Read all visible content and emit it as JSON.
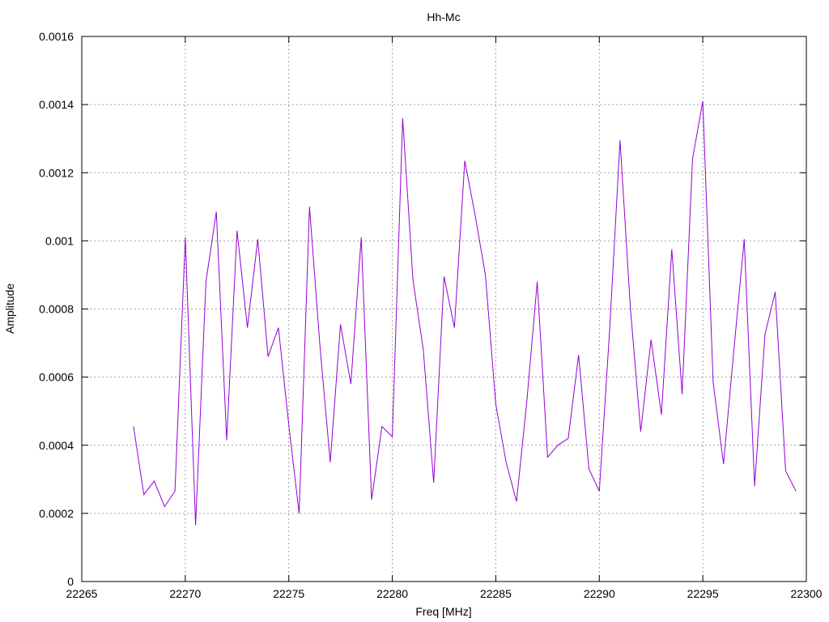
{
  "chart_data": {
    "type": "line",
    "title": "Hh-Mc",
    "xlabel": "Freq [MHz]",
    "ylabel": "Amplitude",
    "xlim": [
      22265,
      22300
    ],
    "ylim": [
      0,
      0.0016
    ],
    "x_ticks": [
      22265,
      22270,
      22275,
      22280,
      22285,
      22290,
      22295,
      22300
    ],
    "x_tick_labels": [
      "22265",
      "22270",
      "22275",
      "22280",
      "22285",
      "22290",
      "22295",
      "22300"
    ],
    "y_ticks": [
      0,
      0.0002,
      0.0004,
      0.0006,
      0.0008,
      0.001,
      0.0012,
      0.0014,
      0.0016
    ],
    "y_tick_labels": [
      "0",
      "0.0002",
      "0.0004",
      "0.0006",
      "0.0008",
      "0.001",
      "0.0012",
      "0.0014",
      "0.0016"
    ],
    "grid": true,
    "series": [
      {
        "color": "#9400d3",
        "x": [
          22267.5,
          22268.0,
          22268.5,
          22269.0,
          22269.5,
          22270.0,
          22270.5,
          22271.0,
          22271.5,
          22272.0,
          22272.5,
          22273.0,
          22273.5,
          22274.0,
          22274.5,
          22275.0,
          22275.5,
          22276.0,
          22276.5,
          22277.0,
          22277.5,
          22278.0,
          22278.5,
          22279.0,
          22279.5,
          22280.0,
          22280.5,
          22281.0,
          22281.5,
          22282.0,
          22282.5,
          22283.0,
          22283.5,
          22284.0,
          22284.5,
          22285.0,
          22285.5,
          22286.0,
          22286.5,
          22287.0,
          22287.5,
          22288.0,
          22288.5,
          22289.0,
          22289.5,
          22290.0,
          22290.5,
          22291.0,
          22291.5,
          22292.0,
          22292.5,
          22293.0,
          22293.5,
          22294.0,
          22294.5,
          22295.0,
          22295.5,
          22296.0,
          22296.5,
          22297.0,
          22297.5,
          22298.0,
          22298.5,
          22299.0,
          22299.5
        ],
        "y": [
          0.000455,
          0.000255,
          0.000295,
          0.00022,
          0.000265,
          0.00101,
          0.000165,
          0.00088,
          0.001085,
          0.000415,
          0.00103,
          0.000745,
          0.001005,
          0.00066,
          0.000745,
          0.00046,
          0.0002,
          0.0011,
          0.000695,
          0.00035,
          0.000755,
          0.00058,
          0.00101,
          0.00024,
          0.000455,
          0.000425,
          0.00136,
          0.000885,
          0.00068,
          0.00029,
          0.000895,
          0.000745,
          0.001235,
          0.001075,
          0.0009,
          0.00052,
          0.00035,
          0.000235,
          0.00053,
          0.00088,
          0.000365,
          0.0004,
          0.00042,
          0.000665,
          0.00033,
          0.000265,
          0.00074,
          0.001295,
          0.000805,
          0.00044,
          0.00071,
          0.00049,
          0.000975,
          0.00055,
          0.00124,
          0.00141,
          0.000585,
          0.000345,
          0.00068,
          0.001005,
          0.00028,
          0.000725,
          0.00085,
          0.000325,
          0.000265
        ]
      }
    ]
  }
}
